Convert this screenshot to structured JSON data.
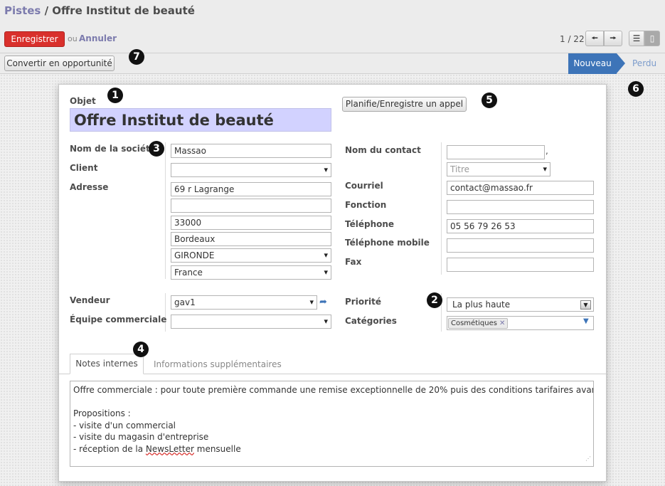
{
  "breadcrumb": {
    "parent": "Pistes",
    "separator": " / ",
    "current": "Offre Institut de beauté"
  },
  "toolbar": {
    "save_label": "Enregistrer",
    "or_text": "ou",
    "cancel_label": "Annuler"
  },
  "pager": {
    "text": "1 / 22",
    "prev_icon": "arrow-left-icon",
    "next_icon": "arrow-right-icon"
  },
  "view_switcher": {
    "list_icon": "list-view-icon",
    "form_icon": "form-view-icon",
    "active": "form"
  },
  "statusbar": {
    "convert_label": "Convertir en opportunité",
    "stages": [
      {
        "label": "Nouveau",
        "active": true
      },
      {
        "label": "Perdu",
        "active": false
      }
    ],
    "active_color": "#3d74b8"
  },
  "form": {
    "objet_label": "Objet",
    "objet_value": "Offre Institut de beauté",
    "call_button": "Planifie/Enregistre un appel",
    "left": {
      "company_label": "Nom de la société",
      "company_value": "Massao",
      "client_label": "Client",
      "client_value": "",
      "address_label": "Adresse",
      "street": "69 r Lagrange",
      "street2": "",
      "zip": "33000",
      "city": "Bordeaux",
      "state": "GIRONDE",
      "country": "France"
    },
    "right": {
      "contact_label": "Nom du contact",
      "contact_value": "",
      "comma": ",",
      "title_placeholder": "Titre",
      "email_label": "Courriel",
      "email_value": "contact@massao.fr",
      "function_label": "Fonction",
      "function_value": "",
      "phone_label": "Téléphone",
      "phone_value": "05 56 79 26 53",
      "mobile_label": "Téléphone mobile",
      "mobile_value": "",
      "fax_label": "Fax",
      "fax_value": ""
    },
    "sales": {
      "salesperson_label": "Vendeur",
      "salesperson_value": "gav1",
      "team_label": "Équipe commerciale",
      "team_value": "",
      "priority_label": "Priorité",
      "priority_value": "La plus haute",
      "categories_label": "Catégories",
      "categories": [
        "Cosmétiques"
      ]
    },
    "tabs": [
      {
        "label": "Notes internes",
        "active": true
      },
      {
        "label": "Informations supplémentaires",
        "active": false
      }
    ],
    "notes": {
      "line1": "Offre commerciale : pour toute première commande une remise exceptionnelle de 20% puis des conditions tarifaires avantageuses",
      "line2": "",
      "line3": "Propositions :",
      "line4": "- visite d'un commercial",
      "line5": "- visite du magasin d'entreprise",
      "line6_pre": "- réception de la ",
      "line6_word": "NewsLetter",
      "line6_post": " mensuelle"
    }
  },
  "annotations": {
    "b1": "1",
    "b2": "2",
    "b3": "3",
    "b4": "4",
    "b5": "5",
    "b6": "6",
    "b7": "7"
  }
}
